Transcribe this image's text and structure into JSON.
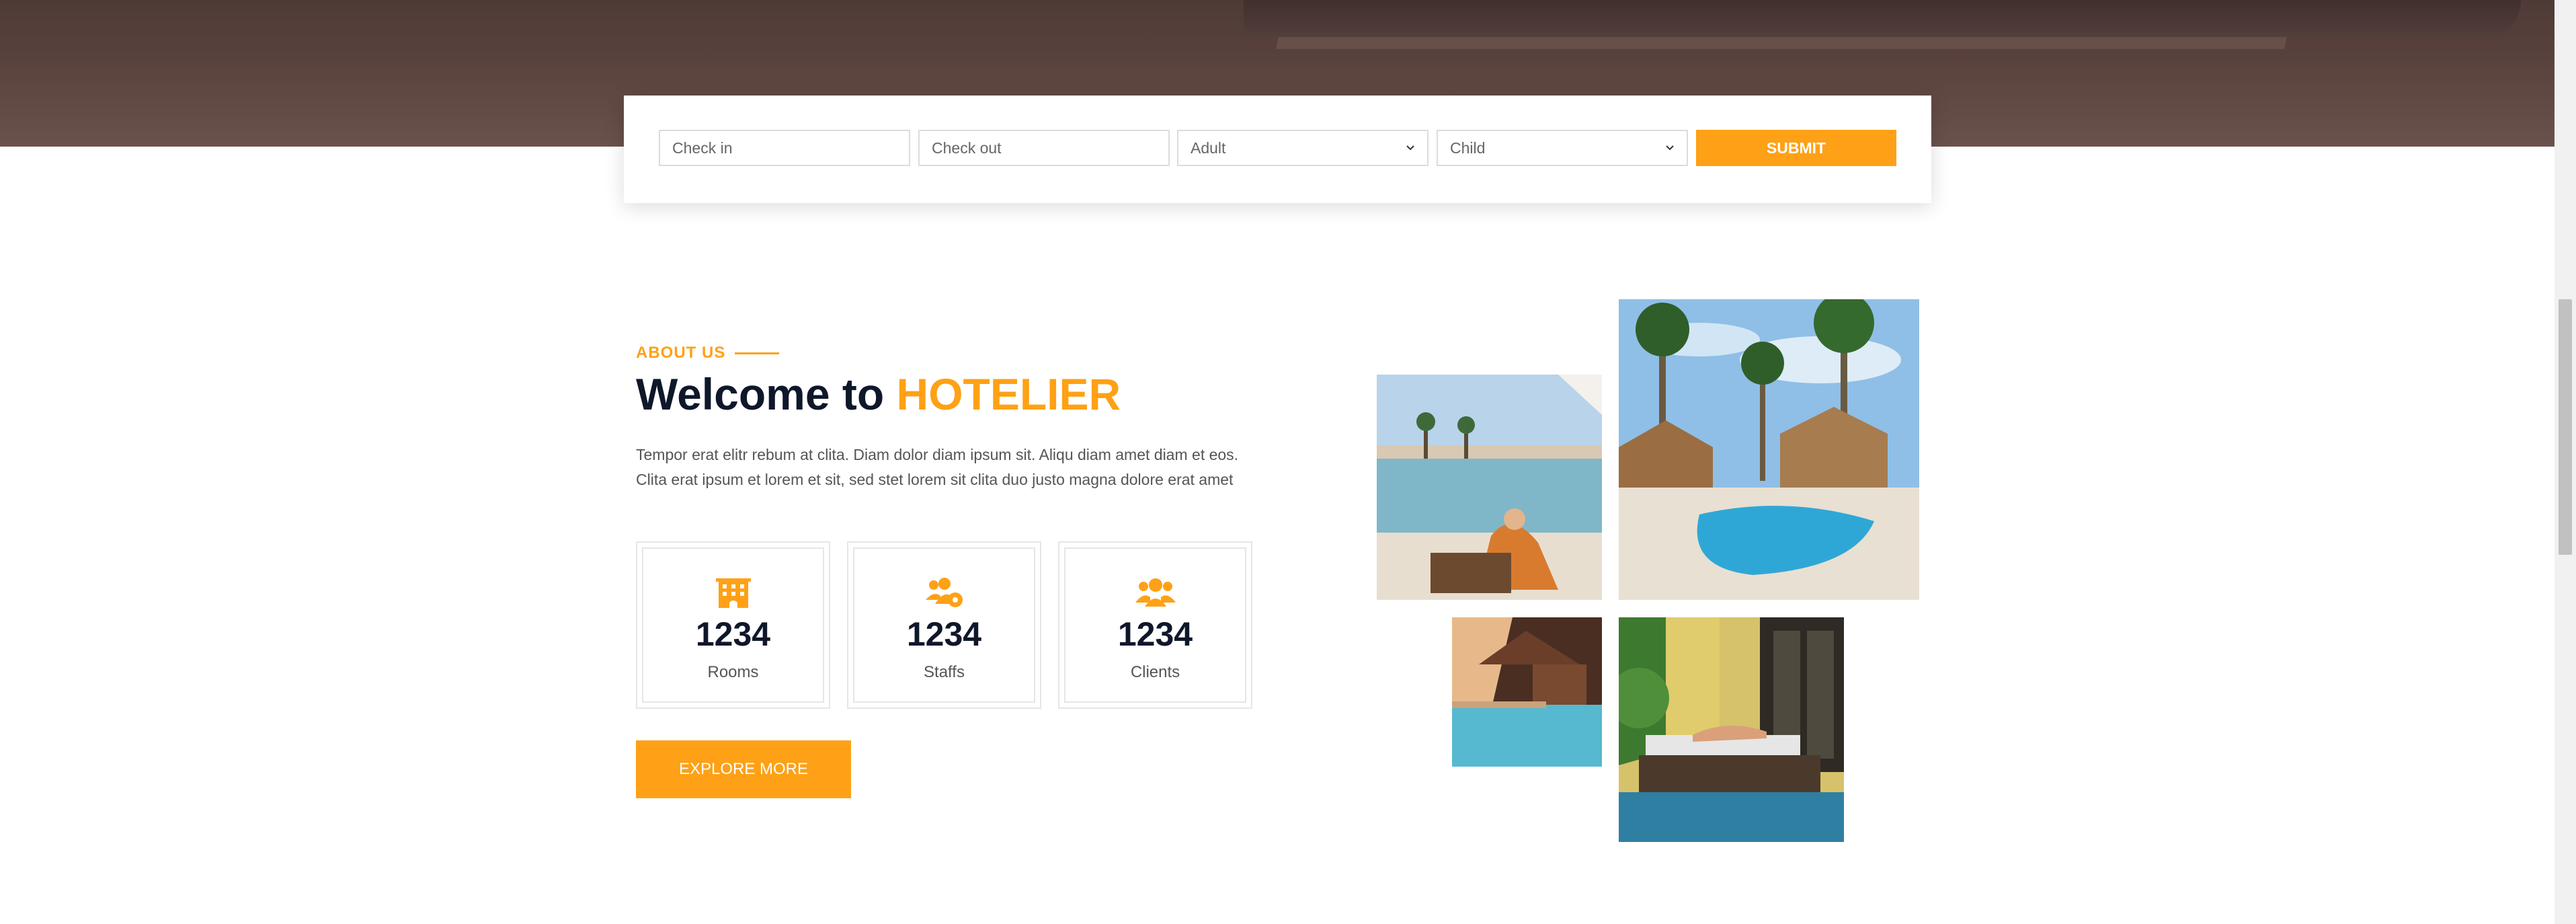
{
  "booking": {
    "check_in_placeholder": "Check in",
    "check_out_placeholder": "Check out",
    "adult_selected": "Adult",
    "child_selected": "Child",
    "submit_label": "SUBMIT"
  },
  "about": {
    "eyebrow": "ABOUT US",
    "title_prefix": "Welcome to",
    "title_brand": "HOTELIER",
    "description": "Tempor erat elitr rebum at clita. Diam dolor diam ipsum sit. Aliqu diam amet diam et eos. Clita erat ipsum et lorem et sit, sed stet lorem sit clita duo justo magna dolore erat amet",
    "stats": [
      {
        "icon": "hotel-icon",
        "value": "1234",
        "label": "Rooms"
      },
      {
        "icon": "users-cog-icon",
        "value": "1234",
        "label": "Staffs"
      },
      {
        "icon": "users-icon",
        "value": "1234",
        "label": "Clients"
      }
    ],
    "explore_label": "EXPLORE MORE"
  },
  "colors": {
    "accent": "#fea116",
    "dark": "#0f172b"
  }
}
